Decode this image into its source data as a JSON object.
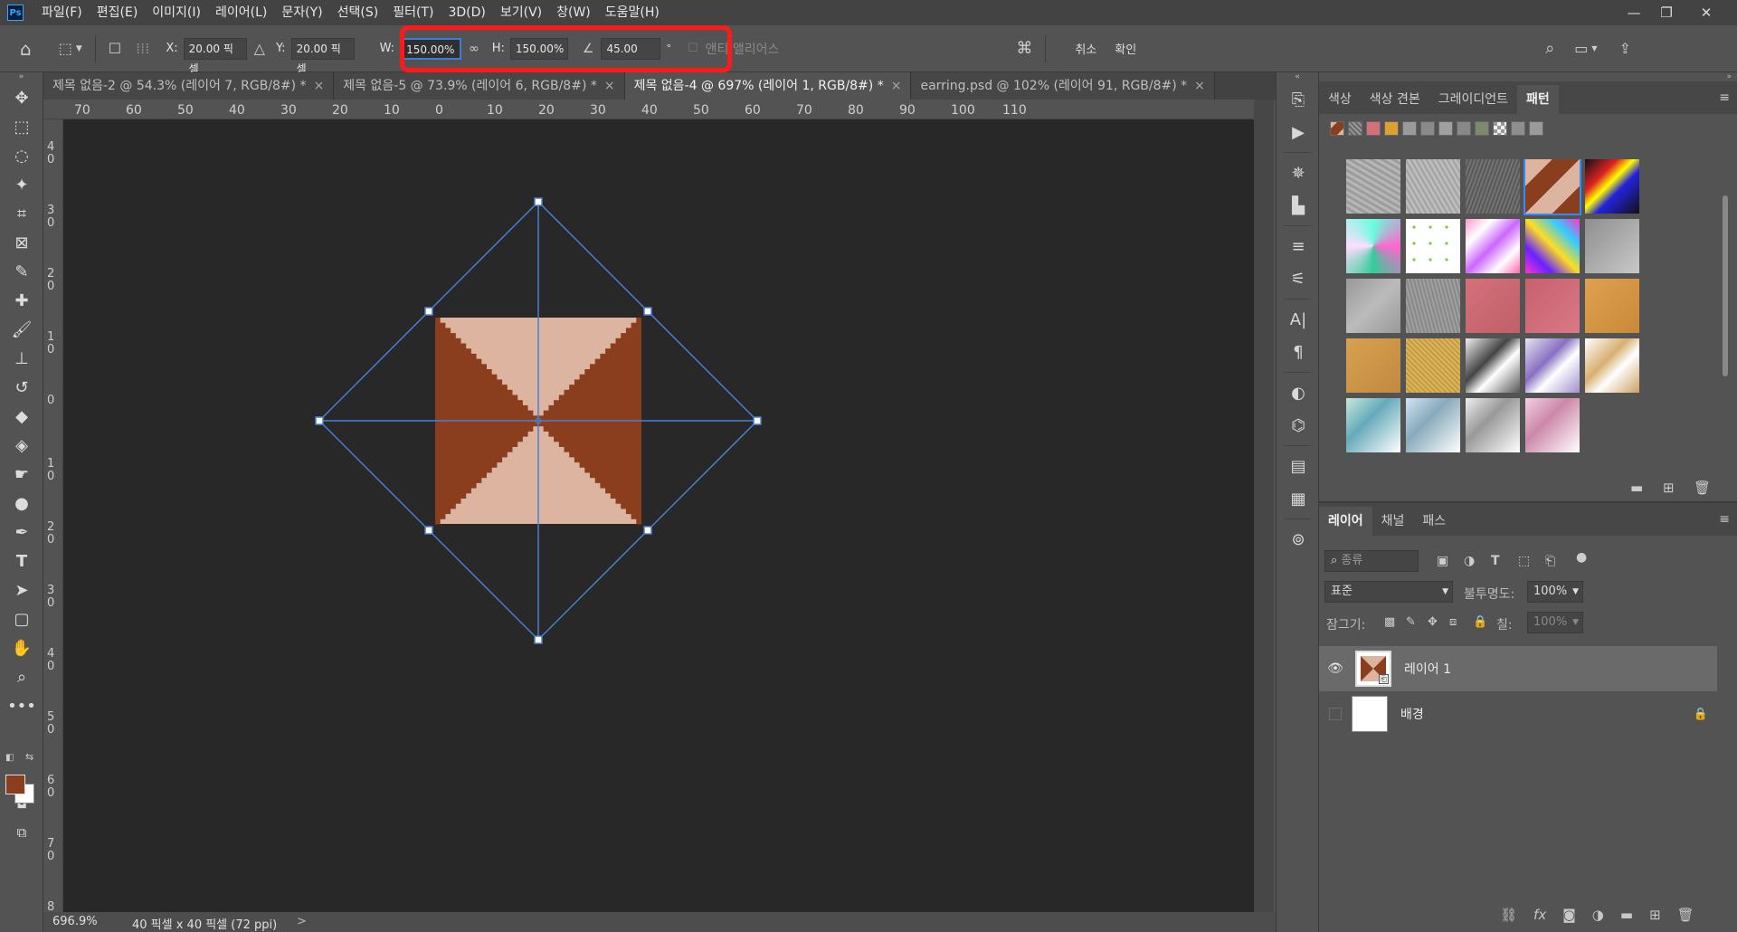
{
  "menubar": {
    "items": [
      "파일(F)",
      "편집(E)",
      "이미지(I)",
      "레이어(L)",
      "문자(Y)",
      "선택(S)",
      "필터(T)",
      "3D(D)",
      "보기(V)",
      "창(W)",
      "도움말(H)"
    ]
  },
  "options": {
    "x_label": "X:",
    "x_value": "20.00 픽셀",
    "y_label": "Y:",
    "y_value": "20.00 픽셀",
    "w_label": "W:",
    "w_value": "150.00%",
    "h_label": "H:",
    "h_value": "150.00%",
    "angle_value": "45.00",
    "degree": "°",
    "antialias_label": "앤티 앨리어스",
    "cancel_label": "취소",
    "commit_label": "확인"
  },
  "tabs": [
    {
      "label": "제목 없음-2 @ 54.3% (레이어 7, RGB/8#) *",
      "active": false
    },
    {
      "label": "제목 없음-5 @ 73.9% (레이어 6, RGB/8#) *",
      "active": false
    },
    {
      "label": "제목 없음-4 @ 697% (레이어 1, RGB/8#) *",
      "active": true
    },
    {
      "label": "earring.psd @ 102% (레이어 91, RGB/8#) *",
      "active": false
    }
  ],
  "ruler_top": [
    "70",
    "60",
    "50",
    "40",
    "30",
    "20",
    "10",
    "0",
    "10",
    "20",
    "30",
    "40",
    "50",
    "60",
    "70",
    "80",
    "90",
    "100",
    "110"
  ],
  "ruler_left": [
    "4 0",
    "3 0",
    "2 0",
    "1 0",
    "0",
    "1 0",
    "2 0",
    "3 0",
    "4 0",
    "5 0",
    "6 0",
    "7 0",
    "8"
  ],
  "status": {
    "zoom": "696.9%",
    "doc_info": "40 픽셀 x 40 픽셀 (72 ppi)",
    "arrow": ">"
  },
  "swatches_panel": {
    "tabs": [
      "색상",
      "색상 견본",
      "그레이디언트",
      "패턴"
    ],
    "active_tab": "패턴"
  },
  "layers_panel": {
    "tabs": [
      "레이어",
      "채널",
      "패스"
    ],
    "filter_placeholder": "종류",
    "blend_mode": "표준",
    "opacity_label": "불투명도:",
    "opacity_value": "100%",
    "lock_label": "잠그기:",
    "fill_label": "칠:",
    "fill_value": "100%",
    "layers": [
      {
        "name": "레이어 1",
        "visible": true,
        "selected": true
      },
      {
        "name": "배경",
        "visible": false,
        "selected": false,
        "locked": true
      }
    ]
  },
  "colors": {
    "brown": "#8b3e1e",
    "peach": "#dcb4a0",
    "transform_line": "#4a7fd0",
    "highlight": "#ff1a1a"
  }
}
